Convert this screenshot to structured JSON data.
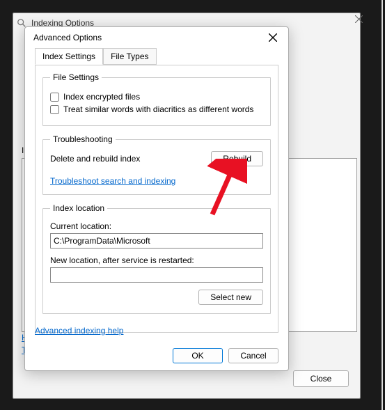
{
  "outerWindow": {
    "title": "Indexing Options",
    "partialLabel": "I",
    "link1": "H",
    "link2": "T",
    "closeBtn": "Close"
  },
  "dialog": {
    "title": "Advanced Options",
    "tabs": {
      "indexSettings": "Index Settings",
      "fileTypes": "File Types"
    },
    "fileSettings": {
      "legend": "File Settings",
      "encrypted": "Index encrypted files",
      "diacritics": "Treat similar words with diacritics as different words"
    },
    "troubleshooting": {
      "legend": "Troubleshooting",
      "deleteRebuild": "Delete and rebuild index",
      "rebuildBtn": "Rebuild",
      "troubleshootLink": "Troubleshoot search and indexing"
    },
    "indexLocation": {
      "legend": "Index location",
      "currentLabel": "Current location:",
      "currentValue": "C:\\ProgramData\\Microsoft",
      "newLabel": "New location, after service is restarted:",
      "newValue": "",
      "selectNewBtn": "Select new"
    },
    "helpLink": "Advanced indexing help",
    "okBtn": "OK",
    "cancelBtn": "Cancel"
  }
}
